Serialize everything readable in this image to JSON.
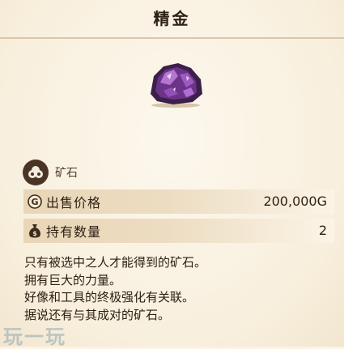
{
  "item": {
    "name": "精金",
    "category": "矿石",
    "category_icon": "ore-pile-icon",
    "art_icon": "purple-ore-crystal-icon"
  },
  "stats": {
    "sell_price_label": "出售价格",
    "sell_price_value": "200,000G",
    "sell_icon": "gold-coin-icon",
    "held_label": "持有数量",
    "held_value": "2",
    "held_icon": "money-bag-icon"
  },
  "description": [
    "只有被选中之人才能得到的矿石。",
    "拥有巨大的力量。",
    "好像和工具的终极强化有关联。",
    "据说还有与其成对的矿石。"
  ],
  "watermark": "玩一玩",
  "colors": {
    "background": "#fbf4e6",
    "row_band": "#e9d6b7",
    "text": "#2e2014",
    "ore_purple": "#7a3a9a"
  }
}
